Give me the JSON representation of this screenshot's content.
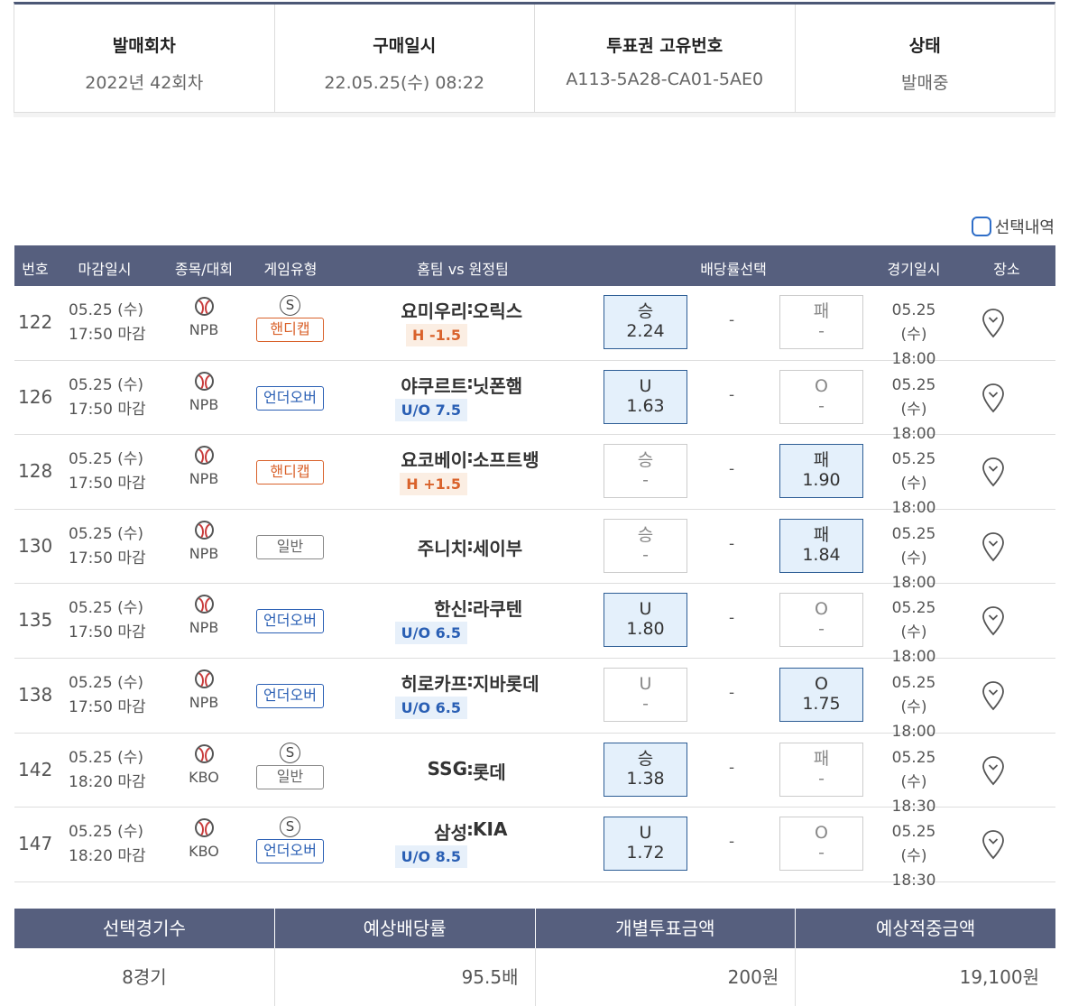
{
  "info": [
    {
      "label": "발매회차",
      "value": "2022년 42회차"
    },
    {
      "label": "구매일시",
      "value": "22.05.25(수) 08:22"
    },
    {
      "label": "투표권 고유번호",
      "value": "A113-5A28-CA01-5AE0"
    },
    {
      "label": "상태",
      "value": "발매중"
    }
  ],
  "select_history_label": "선택내역",
  "table_headers": [
    "번호",
    "마감일시",
    "종목/대회",
    "게임유형",
    "홈팀 vs 원정팀",
    "배당률선택",
    "경기일시",
    "장소"
  ],
  "rows": [
    {
      "no": "122",
      "deadline_date": "05.25 (수)",
      "deadline_time": "17:50 마감",
      "league": "NPB",
      "s": "S",
      "type": "핸디캡",
      "home": "요미우리",
      "colon": ":",
      "away": "오릭스",
      "hcap": "H -1.5",
      "left_label": "승",
      "left_odds": "2.24",
      "mid": "-",
      "right_label": "패",
      "right_odds": "-",
      "game_date": "05.25 (수)",
      "game_time": "18:00"
    },
    {
      "no": "126",
      "deadline_date": "05.25 (수)",
      "deadline_time": "17:50 마감",
      "league": "NPB",
      "s": "",
      "type": "언더오버",
      "home": "야쿠르트",
      "colon": ":",
      "away": "닛폰햄",
      "hcap": "U/O 7.5",
      "left_label": "U",
      "left_odds": "1.63",
      "mid": "-",
      "right_label": "O",
      "right_odds": "-",
      "game_date": "05.25 (수)",
      "game_time": "18:00"
    },
    {
      "no": "128",
      "deadline_date": "05.25 (수)",
      "deadline_time": "17:50 마감",
      "league": "NPB",
      "s": "",
      "type": "핸디캡",
      "home": "요코베이",
      "colon": ":",
      "away": "소프트뱅",
      "hcap": "H +1.5",
      "left_label": "승",
      "left_odds": "-",
      "mid": "-",
      "right_label": "패",
      "right_odds": "1.90",
      "game_date": "05.25 (수)",
      "game_time": "18:00"
    },
    {
      "no": "130",
      "deadline_date": "05.25 (수)",
      "deadline_time": "17:50 마감",
      "league": "NPB",
      "s": "",
      "type": "일반",
      "home": "주니치",
      "colon": ":",
      "away": "세이부",
      "hcap": "",
      "left_label": "승",
      "left_odds": "-",
      "mid": "-",
      "right_label": "패",
      "right_odds": "1.84",
      "game_date": "05.25 (수)",
      "game_time": "18:00"
    },
    {
      "no": "135",
      "deadline_date": "05.25 (수)",
      "deadline_time": "17:50 마감",
      "league": "NPB",
      "s": "",
      "type": "언더오버",
      "home": "한신",
      "colon": ":",
      "away": "라쿠텐",
      "hcap": "U/O 6.5",
      "left_label": "U",
      "left_odds": "1.80",
      "mid": "-",
      "right_label": "O",
      "right_odds": "-",
      "game_date": "05.25 (수)",
      "game_time": "18:00"
    },
    {
      "no": "138",
      "deadline_date": "05.25 (수)",
      "deadline_time": "17:50 마감",
      "league": "NPB",
      "s": "",
      "type": "언더오버",
      "home": "히로카프",
      "colon": ":",
      "away": "지바롯데",
      "hcap": "U/O 6.5",
      "left_label": "U",
      "left_odds": "-",
      "mid": "-",
      "right_label": "O",
      "right_odds": "1.75",
      "game_date": "05.25 (수)",
      "game_time": "18:00"
    },
    {
      "no": "142",
      "deadline_date": "05.25 (수)",
      "deadline_time": "18:20 마감",
      "league": "KBO",
      "s": "S",
      "type": "일반",
      "home": "SSG",
      "colon": ":",
      "away": "롯데",
      "hcap": "",
      "left_label": "승",
      "left_odds": "1.38",
      "mid": "-",
      "right_label": "패",
      "right_odds": "-",
      "game_date": "05.25 (수)",
      "game_time": "18:30"
    },
    {
      "no": "147",
      "deadline_date": "05.25 (수)",
      "deadline_time": "18:20 마감",
      "league": "KBO",
      "s": "S",
      "type": "언더오버",
      "home": "삼성",
      "colon": ":",
      "away": "KIA",
      "hcap": "U/O 8.5",
      "left_label": "U",
      "left_odds": "1.72",
      "mid": "-",
      "right_label": "O",
      "right_odds": "-",
      "game_date": "05.25 (수)",
      "game_time": "18:30"
    }
  ],
  "summary": {
    "headers": [
      "선택경기수",
      "예상배당률",
      "개별투표금액",
      "예상적중금액"
    ],
    "values": [
      "8경기",
      "95.5배",
      "200원",
      "19,100원"
    ]
  },
  "colors": {
    "header_bg": "#565f7e",
    "selected_odds_bg": "#e4f0fb",
    "handicap": "#d9622b",
    "underover": "#2a5fb4"
  },
  "icons": {
    "league": "baseball-icon",
    "location": "map-pin-icon"
  }
}
